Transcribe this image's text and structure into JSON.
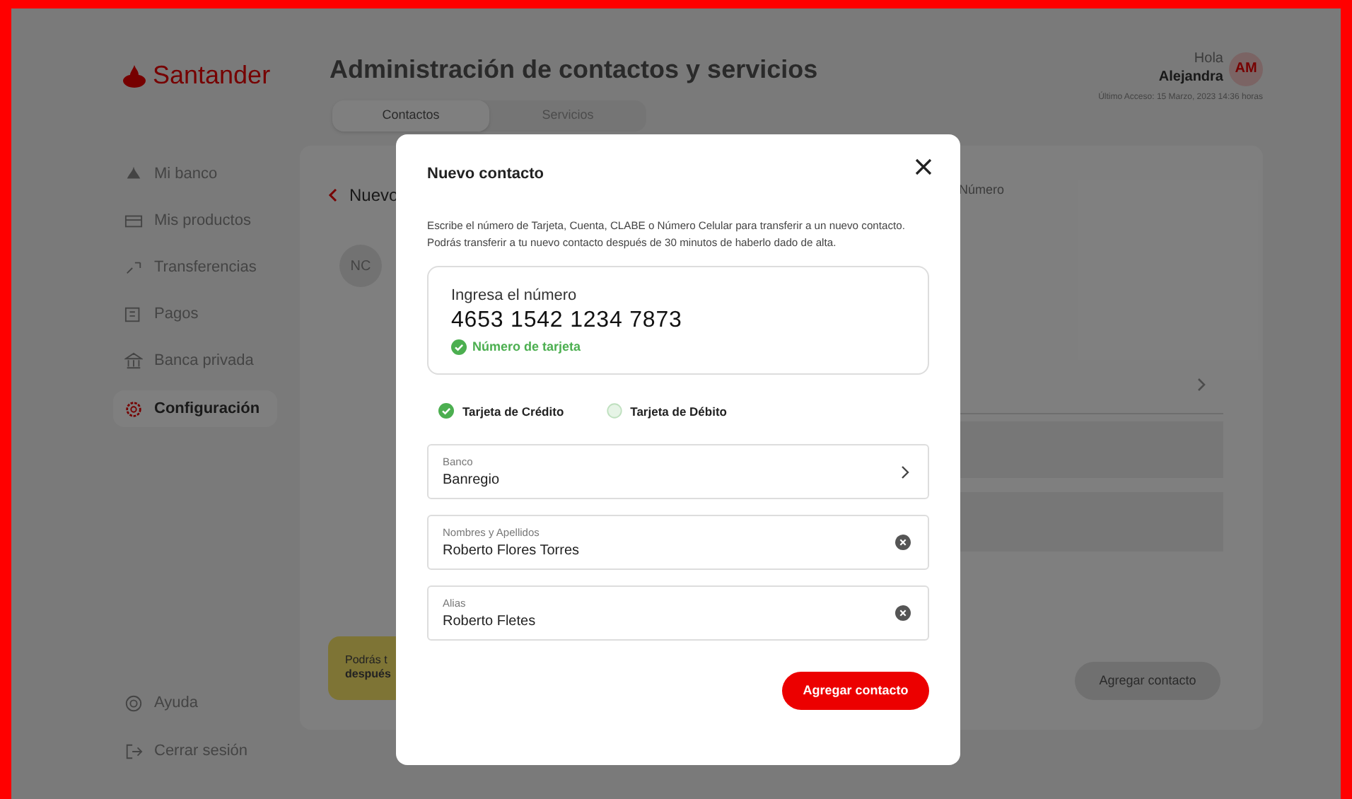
{
  "header": {
    "logo": "Santander",
    "title": "Administración de contactos y servicios",
    "greeting": "Hola",
    "user_name": "Alejandra",
    "avatar_initials": "AM",
    "last_access": "Último Acceso: 15 Marzo, 2023 14:36 horas"
  },
  "tabs": [
    {
      "label": "Contactos",
      "selected": true
    },
    {
      "label": "Servicios",
      "selected": false
    }
  ],
  "sidebar": {
    "items": [
      {
        "label": "Mi banco",
        "selected": false
      },
      {
        "label": "Mis productos",
        "selected": false
      },
      {
        "label": "Transferencias",
        "selected": false
      },
      {
        "label": "Pagos",
        "selected": false
      },
      {
        "label": "Banca privada",
        "selected": false
      },
      {
        "label": "Configuración",
        "selected": true
      }
    ],
    "footer": [
      {
        "label": "Ayuda"
      },
      {
        "label": "Cerrar sesión"
      }
    ]
  },
  "background_panel": {
    "back_label": "Nuevo",
    "avatar_initials": "NC",
    "column_label": "Número",
    "note_line_1": "Podrás t",
    "note_line_2": "después",
    "button": "Agregar contacto"
  },
  "modal": {
    "title": "Nuevo contacto",
    "description": "Escribe el número de Tarjeta, Cuenta, CLABE o Número Celular para transferir a un nuevo contacto. Podrás transferir a tu nuevo contacto después de 30 minutos de haberlo dado de alta.",
    "number_field": {
      "label": "Ingresa el número",
      "value": "4653 1542 1234 7873",
      "validation": "Número de tarjeta"
    },
    "card_types": [
      {
        "label": "Tarjeta de Crédito",
        "selected": true
      },
      {
        "label": "Tarjeta de Débito",
        "selected": false
      }
    ],
    "fields": [
      {
        "kind": "select",
        "label": "Banco",
        "value": "Banregio"
      },
      {
        "kind": "clearable",
        "label": "Nombres y Apellidos",
        "value": "Roberto Flores Torres"
      },
      {
        "kind": "clearable",
        "label": "Alias",
        "value": "Roberto Fletes"
      }
    ],
    "submit": "Agregar contacto"
  }
}
